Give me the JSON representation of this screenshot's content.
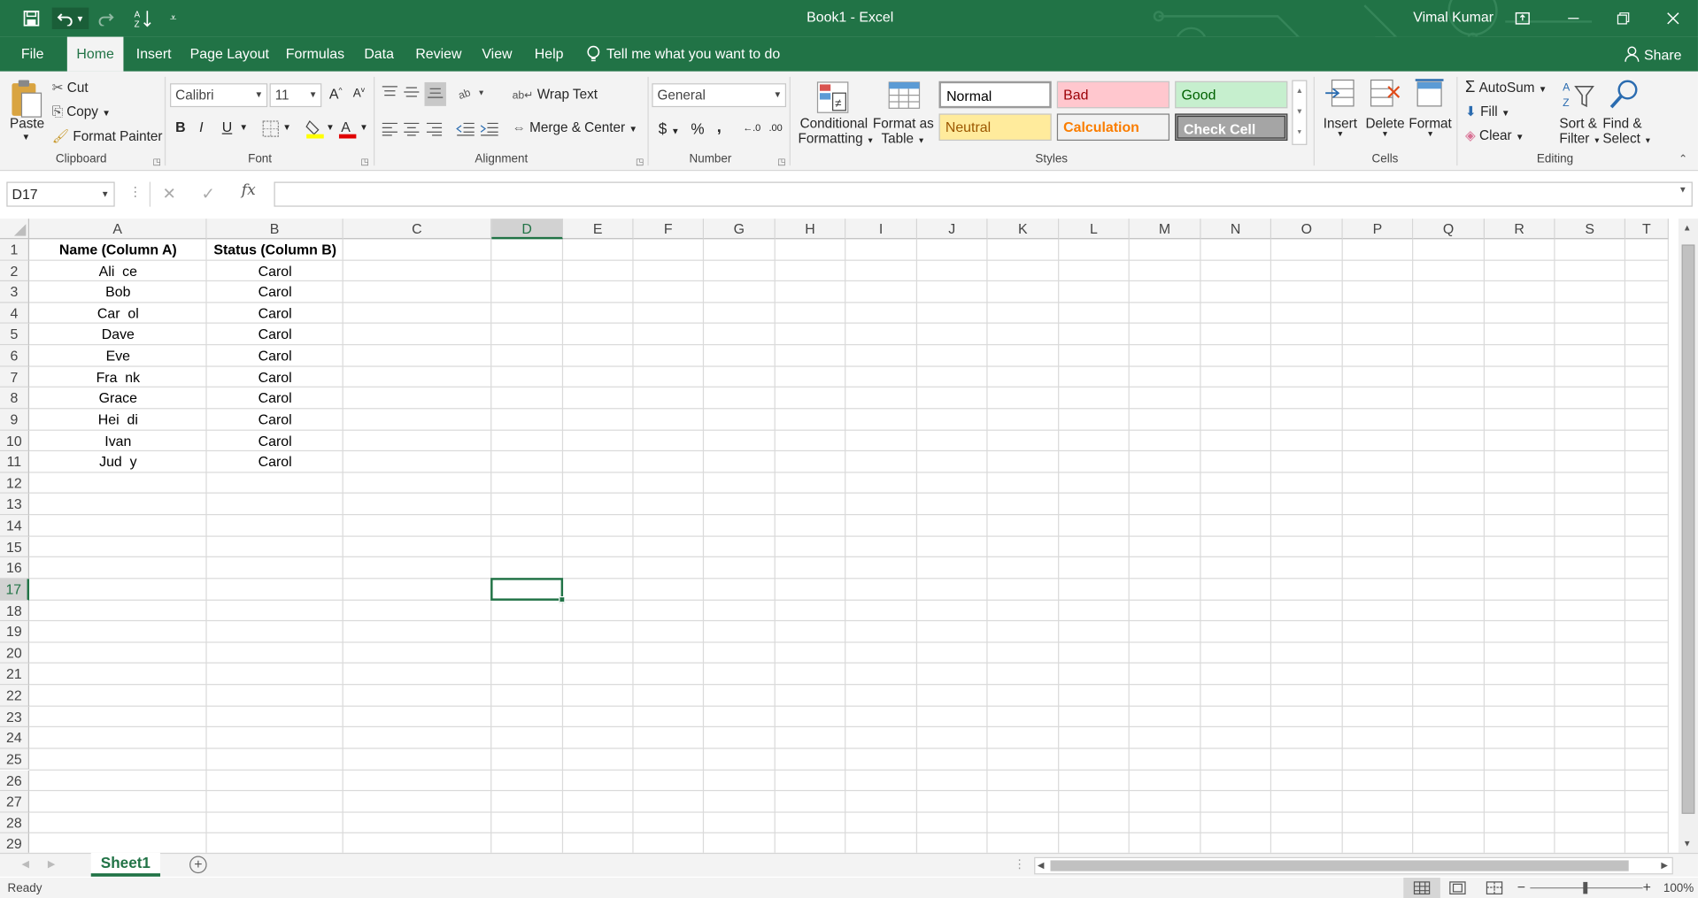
{
  "window": {
    "title": "Book1  -  Excel",
    "user": "Vimal Kumar"
  },
  "qat": {
    "customize_glyph": "⌄"
  },
  "tabs": [
    "File",
    "Home",
    "Insert",
    "Page Layout",
    "Formulas",
    "Data",
    "Review",
    "View",
    "Help"
  ],
  "tell_me": "Tell me what you want to do",
  "share": "Share",
  "clipboard": {
    "paste": "Paste",
    "cut": "Cut",
    "copy": "Copy",
    "format_painter": "Format Painter",
    "label": "Clipboard"
  },
  "font": {
    "name": "Calibri",
    "size": "11",
    "bold": "B",
    "italic": "I",
    "underline": "U",
    "label": "Font",
    "grow": "A",
    "shrink": "A"
  },
  "alignment": {
    "wrap": "Wrap Text",
    "merge": "Merge & Center",
    "label": "Alignment"
  },
  "number": {
    "format": "General",
    "currency": "$",
    "percent": "%",
    "comma": ",",
    "label": "Number",
    "inc_decimal": "←.0",
    "dec_decimal": ".00"
  },
  "styles": {
    "cond_line1": "Conditional",
    "cond_line2": "Formatting",
    "table_line1": "Format as",
    "table_line2": "Table",
    "normal": "Normal",
    "bad": "Bad",
    "good": "Good",
    "neutral": "Neutral",
    "calculation": "Calculation",
    "check": "Check Cell",
    "label": "Styles"
  },
  "cells": {
    "insert": "Insert",
    "delete": "Delete",
    "format": "Format",
    "label": "Cells"
  },
  "editing": {
    "autosum": "AutoSum",
    "fill": "Fill",
    "clear": "Clear",
    "sort1": "Sort &",
    "sort2": "Filter",
    "find1": "Find &",
    "find2": "Select",
    "label": "Editing"
  },
  "formula_bar": {
    "name_box": "D17",
    "fx": "fx",
    "value": ""
  },
  "columns": [
    "A",
    "B",
    "C",
    "D",
    "E",
    "F",
    "G",
    "H",
    "I",
    "J",
    "K",
    "L",
    "M",
    "N",
    "O",
    "P",
    "Q",
    "R",
    "S",
    "T"
  ],
  "rows": [
    "1",
    "2",
    "3",
    "4",
    "5",
    "6",
    "7",
    "8",
    "9",
    "10",
    "11",
    "12",
    "13",
    "14",
    "15",
    "16",
    "17",
    "18",
    "19",
    "20",
    "21",
    "22",
    "23",
    "24",
    "25",
    "26",
    "27",
    "28",
    "29"
  ],
  "table": {
    "headers": [
      "Name (Column A)",
      "Status (Column B)"
    ],
    "data": [
      [
        "Ali  ce",
        "Carol"
      ],
      [
        "Bob",
        "Carol"
      ],
      [
        "Car  ol",
        "Carol"
      ],
      [
        "Dave",
        "Carol"
      ],
      [
        "Eve",
        "Carol"
      ],
      [
        "Fra  nk",
        "Carol"
      ],
      [
        "Grace",
        "Carol"
      ],
      [
        "Hei  di",
        "Carol"
      ],
      [
        "Ivan",
        "Carol"
      ],
      [
        "Jud  y",
        "Carol"
      ]
    ]
  },
  "active_cell": "D17",
  "sheets": [
    "Sheet1"
  ],
  "status": {
    "ready": "Ready",
    "zoom": "100%"
  },
  "colors": {
    "excel_green": "#217346",
    "selection": "#217346"
  }
}
